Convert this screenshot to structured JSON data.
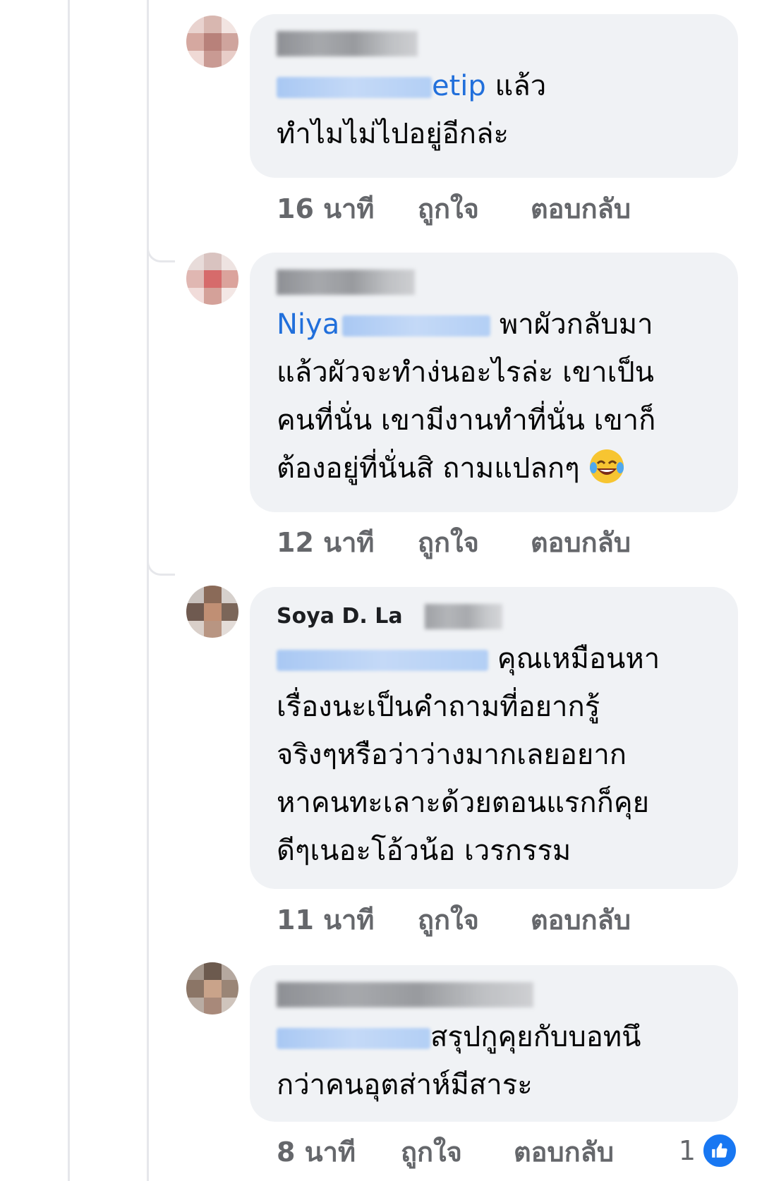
{
  "comments": [
    {
      "author": "",
      "mention": "Theerayut Maneetip",
      "mention_visible": "etip",
      "text_after_mention": " แล้ว",
      "text_lines": [
        "ทำไมไม่ไปอยู่อีกล่ะ"
      ],
      "time": "16 นาที",
      "like_label": "ถูกใจ",
      "reply_label": "ตอบกลับ"
    },
    {
      "author": "",
      "mention": "Niya",
      "mention_visible": "Niya",
      "text_after_mention": " พาผัวกลับมา",
      "text_lines": [
        "แล้วผัวจะทำง่นอะไรล่ะ เขาเป็น",
        "คนที่นั่น เขามีงานทำที่นั่น เขาก็",
        "ต้องอยู่ที่นั่นสิ ถามแปลกๆ"
      ],
      "emoji": "laughing-tears",
      "time": "12 นาที",
      "like_label": "ถูกใจ",
      "reply_label": "ตอบกลับ"
    },
    {
      "author": "Soya D. La",
      "author_visible": "Soya D. La",
      "mention": "",
      "text_after_mention": " คุณเหมือนหา",
      "text_lines": [
        "เรื่องนะเป็นคำถามที่อยากรู้",
        "จริงๆหรือว่าว่างมากเลยอยาก",
        "หาคนทะเลาะด้วยตอนแรกก็คุย",
        "ดีๆเนอะโอ้วน้อ เวรกรรม"
      ],
      "time": "11 นาที",
      "like_label": "ถูกใจ",
      "reply_label": "ตอบกลับ"
    },
    {
      "author": "",
      "mention": "",
      "text_after_mention": "สรุปกูคุยกับบอทนึ",
      "text_lines": [
        "กว่าคนอุตส่าห์มีสาระ"
      ],
      "time": "8 นาที",
      "like_label": "ถูกใจ",
      "reply_label": "ตอบกลับ",
      "reaction_count": "1",
      "reaction_icon": "like-icon"
    }
  ],
  "colors": {
    "bubble": "#f0f2f5",
    "meta_text": "#65676b",
    "mention": "#216fdb",
    "like_blue": "#1877f2"
  }
}
